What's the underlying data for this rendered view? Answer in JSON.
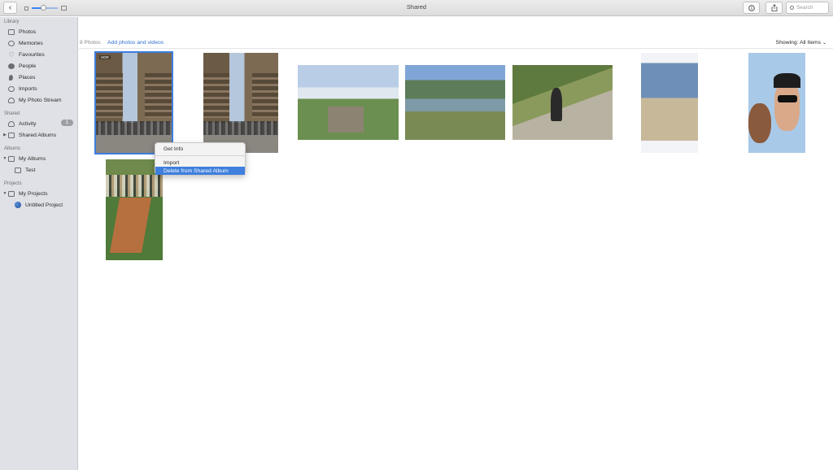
{
  "window": {
    "title": "Shared"
  },
  "toolbar": {
    "back_icon": "chevron-left-icon",
    "zoom_level": 0.45,
    "search_placeholder": "Search"
  },
  "sidebar": {
    "library_title": "Library",
    "library_items": [
      {
        "label": "Photos",
        "icon": "photos-icon"
      },
      {
        "label": "Memories",
        "icon": "memories-icon"
      },
      {
        "label": "Favourites",
        "icon": "heart-icon"
      },
      {
        "label": "People",
        "icon": "person-icon"
      },
      {
        "label": "Places",
        "icon": "pin-icon"
      },
      {
        "label": "Imports",
        "icon": "imports-icon"
      },
      {
        "label": "My Photo Stream",
        "icon": "cloud-icon"
      }
    ],
    "shared_title": "Shared",
    "shared_items": [
      {
        "label": "Activity",
        "icon": "cloud-icon",
        "badge": "1"
      },
      {
        "label": "Shared Albums",
        "icon": "album-icon"
      }
    ],
    "albums_title": "Albums",
    "albums_items": [
      {
        "label": "My Albums",
        "icon": "album-icon"
      },
      {
        "label": "Test",
        "icon": "album-icon"
      }
    ],
    "projects_title": "Projects",
    "projects_items": [
      {
        "label": "My Projects",
        "icon": "album-icon"
      },
      {
        "label": "Untitled Project",
        "icon": "project-icon"
      }
    ]
  },
  "main": {
    "photo_count": "8 Photos",
    "add_link": "Add photos and videos",
    "showing_label": "Showing: All Items",
    "hdr_badge": "HDR"
  },
  "context_menu": {
    "items": [
      "Get Info",
      "Import",
      "Delete from Shared Album"
    ]
  },
  "colors": {
    "accent": "#3f7fdd",
    "link": "#2f6fd1",
    "sidebar_bg": "#dfe1e6"
  }
}
